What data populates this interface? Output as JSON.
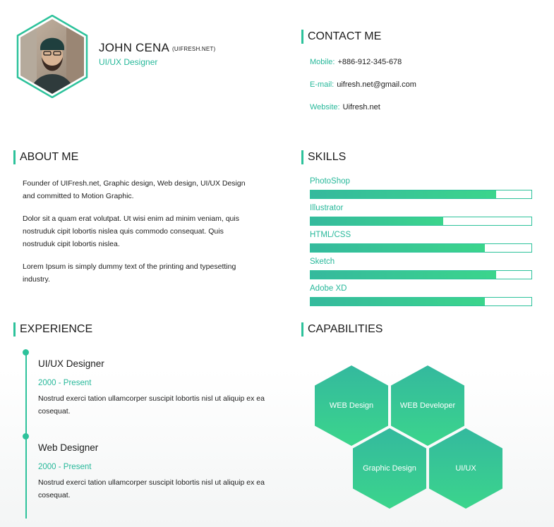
{
  "header": {
    "name": "JOHN CENA",
    "site": "(UIFRESH.NET)",
    "role": "UI/UX Designer"
  },
  "contact": {
    "title": "CONTACT ME",
    "mobile_label": "Mobile:",
    "mobile_value": "+886-912-345-678",
    "email_label": "E-mail:",
    "email_value": "uifresh.net@gmail.com",
    "website_label": "Website:",
    "website_value": "Uifresh.net"
  },
  "about": {
    "title": "ABOUT ME",
    "paragraphs": [
      "Founder of UIFresh.net, Graphic design, Web design, UI/UX Design and committed to  Motion Graphic.",
      "Dolor sit a quam erat volutpat. Ut wisi enim ad minim veniam, quis nostruduk cipit lobortis nislea quis commodo consequat. Quis nostruduk cipit lobortis nislea.",
      "Lorem  Ipsum is simply dummy text of the printing and typesetting industry."
    ]
  },
  "skills": {
    "title": "SKILLS",
    "items": [
      {
        "label": "PhotoShop",
        "level": 0.84
      },
      {
        "label": "Illustrator",
        "level": 0.6
      },
      {
        "label": "HTML/CSS",
        "level": 0.79
      },
      {
        "label": "Sketch",
        "level": 0.84
      },
      {
        "label": "Adobe XD",
        "level": 0.79
      }
    ]
  },
  "experience": {
    "title": "EXPERIENCE",
    "jobs": [
      {
        "title": "UI/UX Designer",
        "period": "2000 - Present",
        "desc": "Nostrud exerci tation ullamcorper suscipit lobortis nisl ut aliquip ex ea cosequat."
      },
      {
        "title": "Web Designer",
        "period": "2000 - Present",
        "desc": "Nostrud exerci tation ullamcorper suscipit lobortis nisl ut aliquip ex ea cosequat."
      }
    ]
  },
  "capabilities": {
    "title": "CAPABILITIES",
    "items": [
      "WEB Design",
      "WEB Developer",
      "Graphic Design",
      "UI/UX"
    ]
  },
  "colors": {
    "accent": "#2dc29b",
    "accent_text": "#27b89a",
    "gradient_start": "#35b99d",
    "gradient_end": "#3bd58c"
  }
}
